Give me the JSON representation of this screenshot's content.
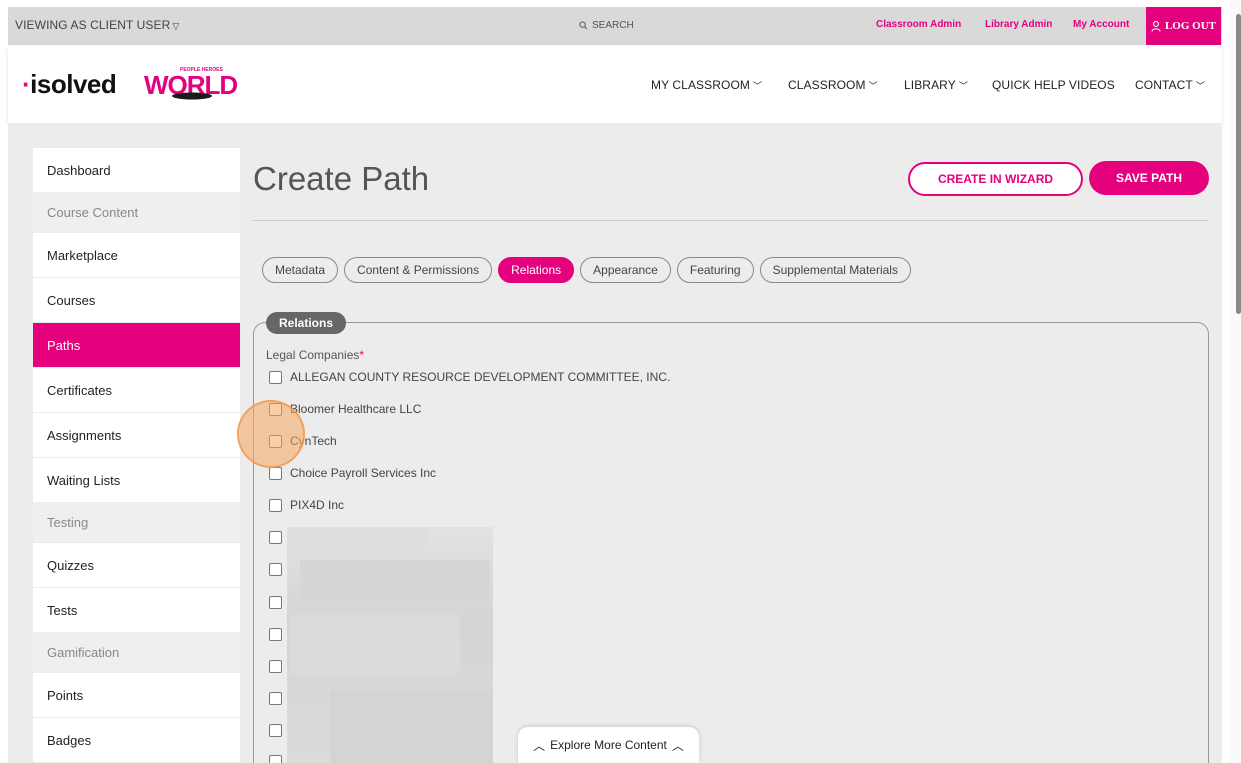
{
  "topbar": {
    "viewing_as": "VIEWING AS CLIENT USER",
    "search_label": "SEARCH",
    "links": [
      "Classroom Admin",
      "Library Admin",
      "My Account"
    ],
    "logout": "LOG OUT"
  },
  "brand": {
    "isolved": "isolved",
    "world_small": "PEOPLE HEROES",
    "world": "WORLD"
  },
  "nav": [
    "MY CLASSROOM",
    "CLASSROOM",
    "LIBRARY",
    "QUICK HELP VIDEOS",
    "CONTACT"
  ],
  "sidebar": {
    "items": [
      {
        "label": "Dashboard"
      },
      {
        "label": "Course Content",
        "section": true
      },
      {
        "label": "Marketplace"
      },
      {
        "label": "Courses"
      },
      {
        "label": "Paths",
        "active": true
      },
      {
        "label": "Certificates"
      },
      {
        "label": "Assignments"
      },
      {
        "label": "Waiting Lists"
      },
      {
        "label": "Testing",
        "section": true
      },
      {
        "label": "Quizzes"
      },
      {
        "label": "Tests"
      },
      {
        "label": "Gamification",
        "section": true
      },
      {
        "label": "Points"
      },
      {
        "label": "Badges"
      }
    ]
  },
  "page": {
    "title": "Create Path",
    "wizard_button": "CREATE IN WIZARD",
    "save_button": "SAVE PATH"
  },
  "tabs": [
    {
      "label": "Metadata"
    },
    {
      "label": "Content & Permissions"
    },
    {
      "label": "Relations",
      "active": true
    },
    {
      "label": "Appearance"
    },
    {
      "label": "Featuring"
    },
    {
      "label": "Supplemental Materials"
    }
  ],
  "relations": {
    "legend": "Relations",
    "field_label": "Legal Companies",
    "required_mark": "*",
    "companies": [
      "ALLEGAN COUNTY RESOURCE DEVELOPMENT COMMITTEE, INC.",
      "Bloomer Healthcare LLC",
      "CynTech",
      "Choice Payroll Services Inc",
      "PIX4D Inc"
    ]
  },
  "explore": "Explore More Content",
  "colors": {
    "accent": "#e5007e",
    "panel_bg": "#ececec"
  }
}
